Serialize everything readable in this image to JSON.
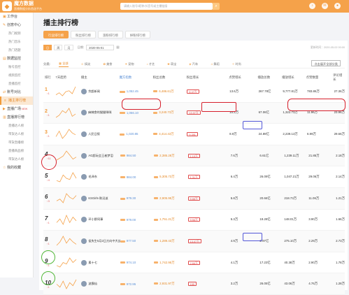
{
  "brand": {
    "logo": "◆",
    "name": "魔方数据",
    "slogan": "直播数据分析首选平台"
  },
  "search": {
    "placeholder": "请输入账号/昵称/抖音号或主播链接"
  },
  "sidebar": [
    {
      "label": "工作台",
      "type": "main",
      "icon": "home-icon",
      "glyph": "▣"
    },
    {
      "label": "创意中心",
      "type": "main",
      "icon": "bulb-icon",
      "glyph": "✎"
    },
    {
      "label": "热门视频",
      "type": "sub"
    },
    {
      "label": "热门音乐",
      "type": "sub"
    },
    {
      "label": "热门话题",
      "type": "sub"
    },
    {
      "label": "数据监控",
      "type": "main",
      "icon": "monitor-icon",
      "glyph": "▤"
    },
    {
      "label": "账号监控",
      "type": "sub"
    },
    {
      "label": "视频监控",
      "type": "sub"
    },
    {
      "label": "直播监控",
      "type": "sub"
    },
    {
      "label": "账号对比",
      "type": "main",
      "icon": "compare-icon",
      "glyph": "⇄"
    },
    {
      "label": "播主排行榜",
      "type": "main",
      "icon": "rank-icon",
      "glyph": "≡",
      "active": true
    },
    {
      "label": "直播广场",
      "type": "main",
      "icon": "live-icon",
      "glyph": "▶",
      "badge": "NEW"
    },
    {
      "label": "直播排行榜",
      "type": "main",
      "icon": "chart-icon",
      "glyph": "▥"
    },
    {
      "label": "直播达人榜",
      "type": "sub"
    },
    {
      "label": "带货达人榜",
      "type": "sub"
    },
    {
      "label": "带货直播榜",
      "type": "sub"
    },
    {
      "label": "直播商品榜",
      "type": "sub"
    },
    {
      "label": "带货达人榜",
      "type": "sub"
    },
    {
      "label": "我的收藏",
      "type": "main",
      "icon": "star-icon",
      "glyph": "☆"
    }
  ],
  "page": {
    "title": "播主排行榜"
  },
  "tabs": [
    "行业排行榜",
    "粉丝排行榜",
    "涨粉排行榜",
    "掉粉排行榜"
  ],
  "date": {
    "periods": [
      "日",
      "周",
      "月"
    ],
    "label": "日期:",
    "value": "2020-05-01",
    "updated": "更新时间：2020-05-02 00:00"
  },
  "categories": {
    "label": "分类:",
    "items": [
      {
        "name": "全部",
        "glyph": "▦"
      },
      {
        "name": "搞笑",
        "glyph": "☺"
      },
      {
        "name": "美食",
        "glyph": "✿"
      },
      {
        "name": "宠物",
        "glyph": "✦"
      },
      {
        "name": "才艺",
        "glyph": "♪"
      },
      {
        "name": "萌宝",
        "glyph": "❀"
      },
      {
        "name": "汽车",
        "glyph": "◈"
      },
      {
        "name": "舞蹈",
        "glyph": "♫"
      },
      {
        "name": "时尚",
        "glyph": "✧"
      }
    ],
    "expand": "点击展开全部分类"
  },
  "columns": [
    "排行",
    "7天趋势",
    "播主",
    "魔方指数",
    "粉丝总数",
    "粉丝增长",
    "点赞增长",
    "播放总数",
    "播放增长",
    "点赞数量",
    "评论增长"
  ],
  "rows": [
    {
      "rank": "1",
      "change": "↑1",
      "name": "余超新闻",
      "index": "1,052.45",
      "fans": "6,486.61万",
      "growth": "8.47万",
      "likes": "13.6万",
      "plays": "267.78亿",
      "play_growth": "9,777.81万",
      "like_count": "783.86万",
      "comments": "27.36万",
      "trend": [
        8,
        10,
        7,
        11,
        12,
        9,
        16
      ]
    },
    {
      "rank": "2",
      "change": "↑1",
      "name": "麻辣食的猫猫咪咪",
      "index": "1,066.10",
      "fans": "3,240.73万",
      "growth": "13.07万",
      "likes": "10.2万",
      "plays": "67.06亿",
      "play_growth": "1,322.73万",
      "like_count": "11.96万",
      "comments": "23.96万",
      "trend": [
        6,
        8,
        12,
        10,
        14,
        7,
        9
      ]
    },
    {
      "rank": "3",
      "change": "↑1",
      "name": "人民日报",
      "index": "1,020.85",
      "fans": "4,414.43万",
      "growth": "9,391",
      "likes": "8.9万",
      "plays": "24.89亿",
      "play_growth": "2,239.13万",
      "like_count": "6.99万",
      "comments": "29.66万",
      "trend": [
        9,
        12,
        8,
        10,
        13,
        11,
        10
      ]
    },
    {
      "rank": "4",
      "change": "↑11",
      "name": "AG超玩会王者梦泪",
      "index": "984.50",
      "fans": "2,385.28万",
      "growth": "1.19万",
      "likes": "7.6万",
      "plays": "6.61亿",
      "play_growth": "1,239.11万",
      "like_count": "21.85万",
      "comments": "2.18万",
      "trend": [
        5,
        7,
        9,
        14,
        10,
        6,
        8
      ]
    },
    {
      "rank": "5",
      "change": "↑4",
      "name": "毛泽东",
      "index": "984.00",
      "fans": "5,305.73万",
      "growth": "1.31万",
      "likes": "6.4万",
      "plays": "26.09亿",
      "play_growth": "1,047.21万",
      "like_count": "29.06万",
      "comments": "2.14万",
      "trend": [
        7,
        6,
        12,
        9,
        8,
        14,
        9
      ]
    },
    {
      "rank": "6",
      "change": "↑3",
      "name": "KSGirls-陈迅逝",
      "index": "979.30",
      "fans": "2,905.95万",
      "growth": "5.88万",
      "likes": "5.8万",
      "plays": "20.66亿",
      "play_growth": "218.73万",
      "like_count": "11.06万",
      "comments": "1.21万",
      "trend": [
        8,
        9,
        7,
        12,
        10,
        9,
        11
      ]
    },
    {
      "rank": "7",
      "change": "↑1",
      "name": "环小野同事",
      "index": "979.00",
      "fans": "1,751.21万",
      "growth": "9.56万",
      "likes": "5.3万",
      "plays": "19.28亿",
      "play_growth": "148.01万",
      "like_count": "3.90万",
      "comments": "1.66万",
      "trend": [
        9,
        11,
        8,
        13,
        9,
        12,
        10
      ]
    },
    {
      "rank": "8",
      "change": "↑1",
      "name": "侯失生5月2日方向中大战略",
      "index": "977.50",
      "fans": "1,289.43万",
      "growth": "13.07万",
      "likes": "4.9万",
      "plays": "2.97亿",
      "play_growth": "275.10万",
      "like_count": "2.29万",
      "comments": "2.73万",
      "trend": [
        6,
        9,
        14,
        8,
        12,
        9,
        7
      ]
    },
    {
      "rank": "9",
      "change": "↑1",
      "name": "素十七",
      "index": "974.10",
      "fans": "1,742.95万",
      "growth": "2.66万",
      "likes": "4.1万",
      "plays": "17.23亿",
      "play_growth": "40.38万",
      "like_count": "2.90万",
      "comments": "1.78万",
      "trend": [
        8,
        7,
        10,
        9,
        13,
        10,
        12
      ]
    },
    {
      "rank": "10",
      "change": "↑1",
      "name": "波霸仙",
      "index": "972.95",
      "fans": "2,931.97万",
      "growth": "155",
      "likes": "3.2万",
      "plays": "26.05亿",
      "play_growth": "43.06万",
      "like_count": "4.76万",
      "comments": "1.28万",
      "trend": [
        10,
        8,
        12,
        7,
        11,
        9,
        13
      ]
    }
  ]
}
